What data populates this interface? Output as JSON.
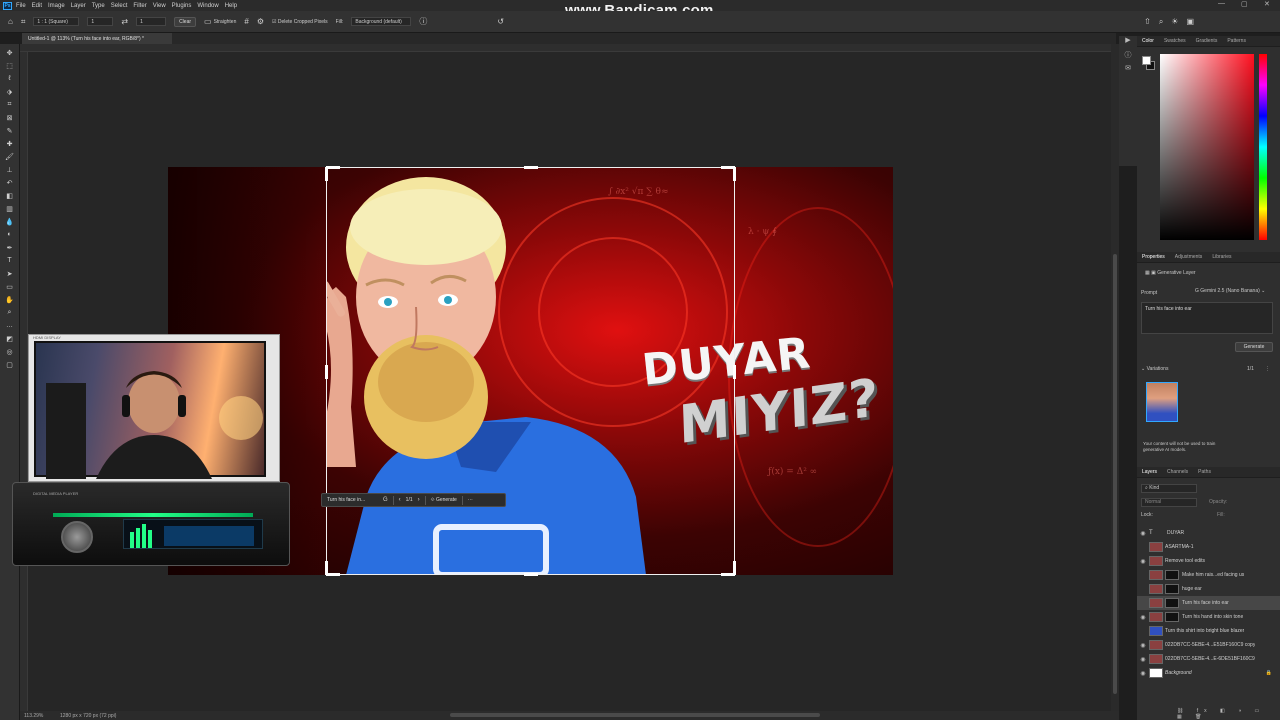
{
  "watermark": "www.Bandicam.com",
  "menubar": {
    "logo": "Ps",
    "items": [
      "File",
      "Edit",
      "Image",
      "Layer",
      "Type",
      "Select",
      "Filter",
      "View",
      "Plugins",
      "Window",
      "Help"
    ]
  },
  "options": {
    "ratio": "1 : 1 (Square)",
    "w": "1",
    "h": "1",
    "clear": "Clear",
    "straighten": "Straighten",
    "delete_cropped": "Delete Cropped Pixels",
    "fill_label": "Fill:",
    "fill_value": "Background (default)"
  },
  "document_tab": "Untitled-1 @ 113% (Turn his face into ear, RGB/8*) *",
  "status": {
    "zoom": "113.29%",
    "size": "1280 px x 720 px (72 ppi)"
  },
  "image": {
    "line1": "DUYAR",
    "line2": "MIYIZ?"
  },
  "gen_bar": {
    "prompt": "Turn his face in...",
    "count": "1/1",
    "generate": "Generate",
    "more": "···"
  },
  "right_panel": {
    "color_tabs": [
      "Color",
      "Swatches",
      "Gradients",
      "Patterns"
    ],
    "props_tabs": [
      "Properties",
      "Adjustments",
      "Libraries"
    ],
    "layer_type": "Generative Layer",
    "prompt_label": "Prompt",
    "model": "Gemini 2.5 (Nano Banana)",
    "prompt_text": "Turn his face into ear",
    "generate_btn": "Generate",
    "variations_label": "Variations",
    "variations_count": "1/1",
    "notice": "Your content will not be used to train generative AI models.",
    "layers_tabs": [
      "Layers",
      "Channels",
      "Paths"
    ],
    "kind_label": "Kind",
    "normal_label": "Normal",
    "opacity_label": "Opacity:",
    "lock_label": "Lock:",
    "fill_label": "Fill:"
  },
  "layers": [
    {
      "name": "DUYAR",
      "type": "text"
    },
    {
      "name": "ASARTMA-1",
      "type": "image"
    },
    {
      "name": "Remove tool edits",
      "type": "image"
    },
    {
      "name": "Make him rais...ed facing us",
      "type": "gen"
    },
    {
      "name": "huge ear",
      "type": "gen"
    },
    {
      "name": "Turn his face into ear",
      "type": "gen",
      "selected": true
    },
    {
      "name": "Turn his hand into skin tone",
      "type": "gen"
    },
    {
      "name": "Turn this shirt into bright blue blazer",
      "type": "gen"
    },
    {
      "name": "022DB7CC-5EBE-4...E51BF160C9 copy",
      "type": "image"
    },
    {
      "name": "022DB7CC-5EBE-4...E-6DE51BF160C9",
      "type": "image"
    },
    {
      "name": "Background",
      "type": "bg"
    }
  ],
  "webcam_label": "HDMI DISPLAY",
  "stereo_label": "DIGITAL MEDIA PLAYER"
}
